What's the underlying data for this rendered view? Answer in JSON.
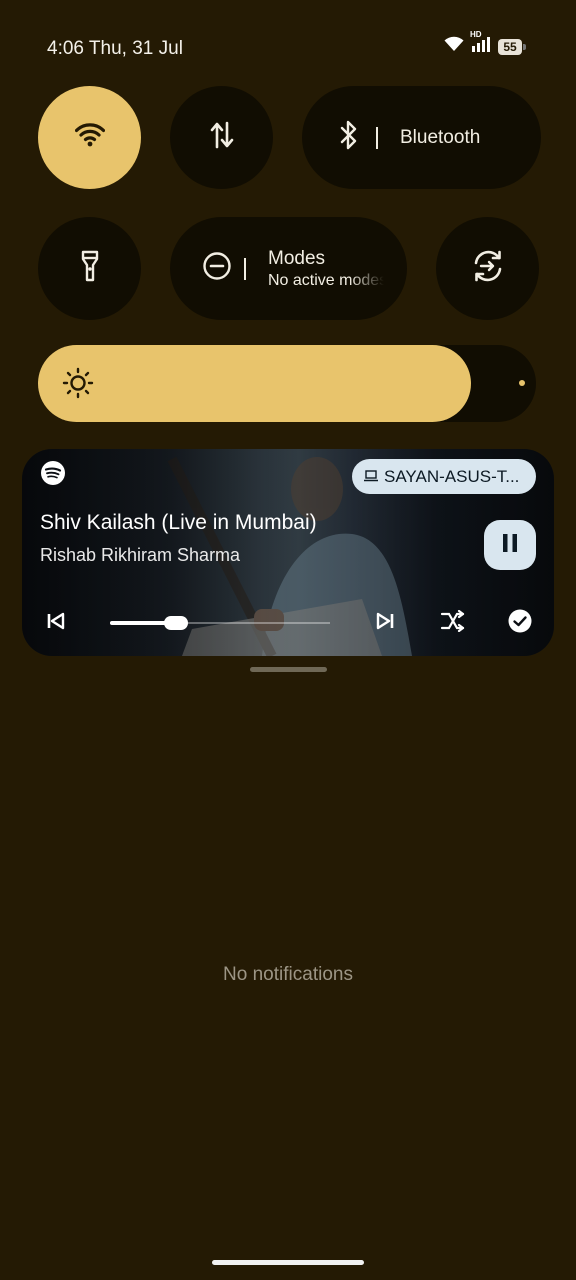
{
  "status_bar": {
    "time": "4:06 Thu, 31 Jul",
    "network_type": "HD",
    "battery_level": "55"
  },
  "quick_settings": {
    "tiles": [
      {
        "id": "wifi",
        "icon": "wifi-icon",
        "active": true
      },
      {
        "id": "mobile-data",
        "icon": "data-transfer-icon",
        "active": false
      },
      {
        "id": "bluetooth",
        "icon": "bluetooth-icon",
        "label": "Bluetooth",
        "active": false
      },
      {
        "id": "flashlight",
        "icon": "flashlight-icon",
        "active": false
      },
      {
        "id": "modes",
        "icon": "do-not-disturb-icon",
        "label": "Modes",
        "sublabel": "No active modes",
        "active": false
      },
      {
        "id": "auto-rotate",
        "icon": "auto-rotate-icon",
        "active": false
      }
    ],
    "brightness": {
      "icon": "brightness-icon",
      "level_fraction": 0.87
    }
  },
  "media_player": {
    "app_icon": "spotify-icon",
    "output_device": "SAYAN-ASUS-T...",
    "title": "Shiv Kailash (Live in Mumbai)",
    "artist": "Rishab Rikhiram Sharma",
    "playback_state": "playing",
    "progress_fraction": 0.3,
    "controls": [
      "previous-icon",
      "next-icon",
      "shuffle-icon",
      "saved-check-icon"
    ]
  },
  "notifications": {
    "empty_text": "No notifications"
  },
  "colors": {
    "background": "#241a04",
    "accent": "#e8c46c",
    "tile_inactive": "#110d02",
    "chip": "#d9e6ef"
  }
}
